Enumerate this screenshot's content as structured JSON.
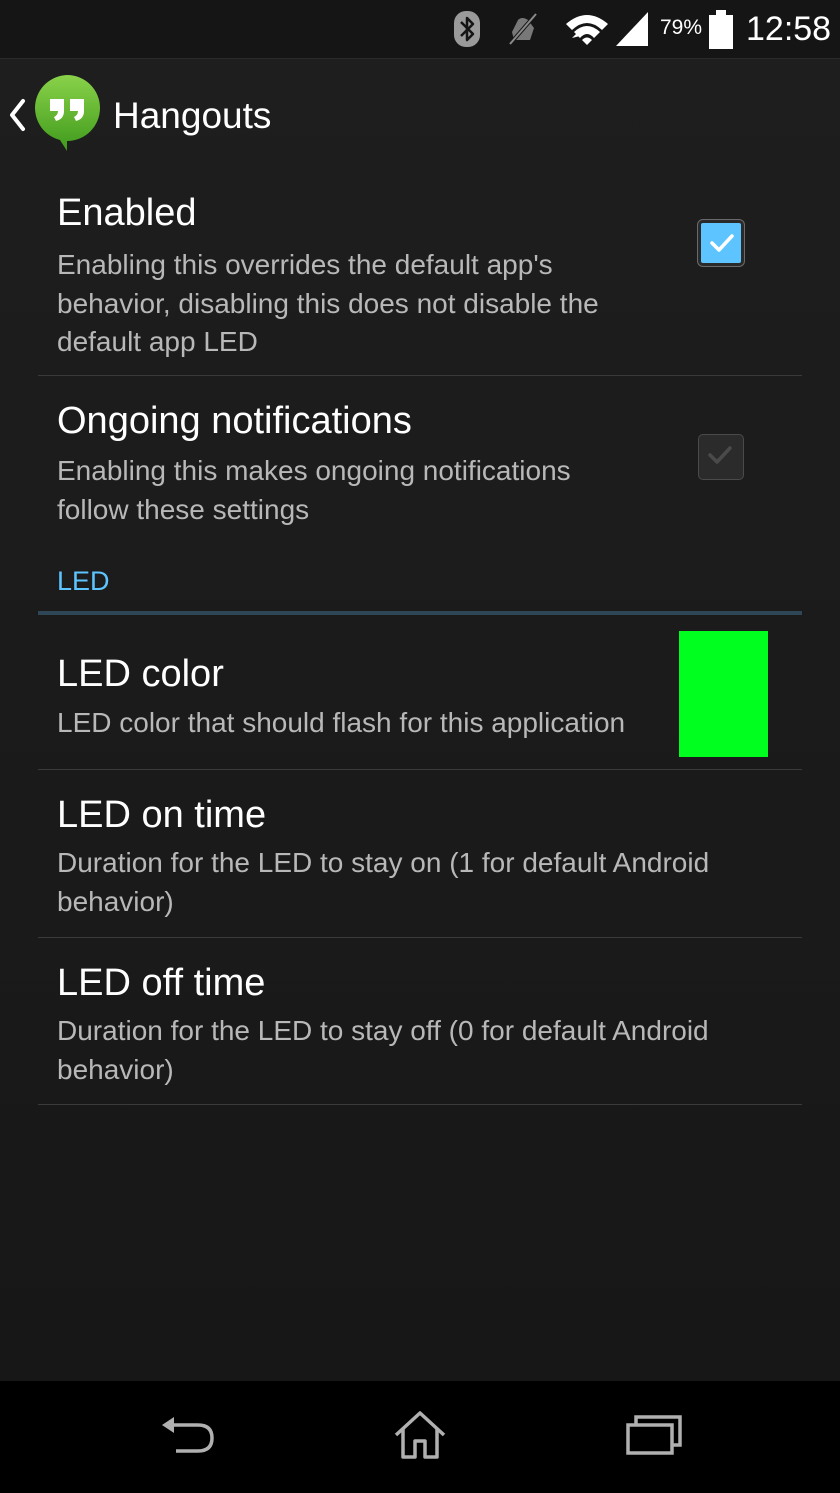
{
  "status_bar": {
    "icons": [
      "bluetooth-icon",
      "muted-icon",
      "wifi-icon",
      "signal-icon",
      "battery-icon"
    ],
    "battery_percent": "79%",
    "time": "12:58"
  },
  "action_bar": {
    "title": "Hangouts",
    "back_icon": "chevron-left-icon",
    "app_icon": "hangouts-logo"
  },
  "preferences": {
    "enabled": {
      "title": "Enabled",
      "summary_lines": [
        "Enabling this overrides the default app's",
        "behavior, disabling this does not disable the",
        "default app LED"
      ],
      "checked": true,
      "enabled": true
    },
    "ongoing": {
      "title": "Ongoing notifications",
      "summary_lines": [
        "Enabling this makes ongoing notifications",
        "follow these settings"
      ],
      "checked": true,
      "enabled": false
    }
  },
  "led_section": {
    "header": "LED",
    "color": {
      "title": "LED color",
      "summary": "LED color that should flash for this application",
      "swatch_color": "#00ff1e"
    },
    "on_time": {
      "title": "LED on time",
      "summary_lines": [
        "Duration for the LED to stay on (1 for default Android",
        "behavior)"
      ]
    },
    "off_time": {
      "title": "LED off time",
      "summary_lines": [
        "Duration for the LED to stay off (0 for default Android",
        "behavior)"
      ]
    }
  },
  "nav_bar": {
    "buttons": [
      "back-icon",
      "home-icon",
      "recents-icon"
    ]
  },
  "colors": {
    "accent": "#5ec4ff",
    "background": "#1b1b1b",
    "summary_text": "#b8b8b8"
  }
}
